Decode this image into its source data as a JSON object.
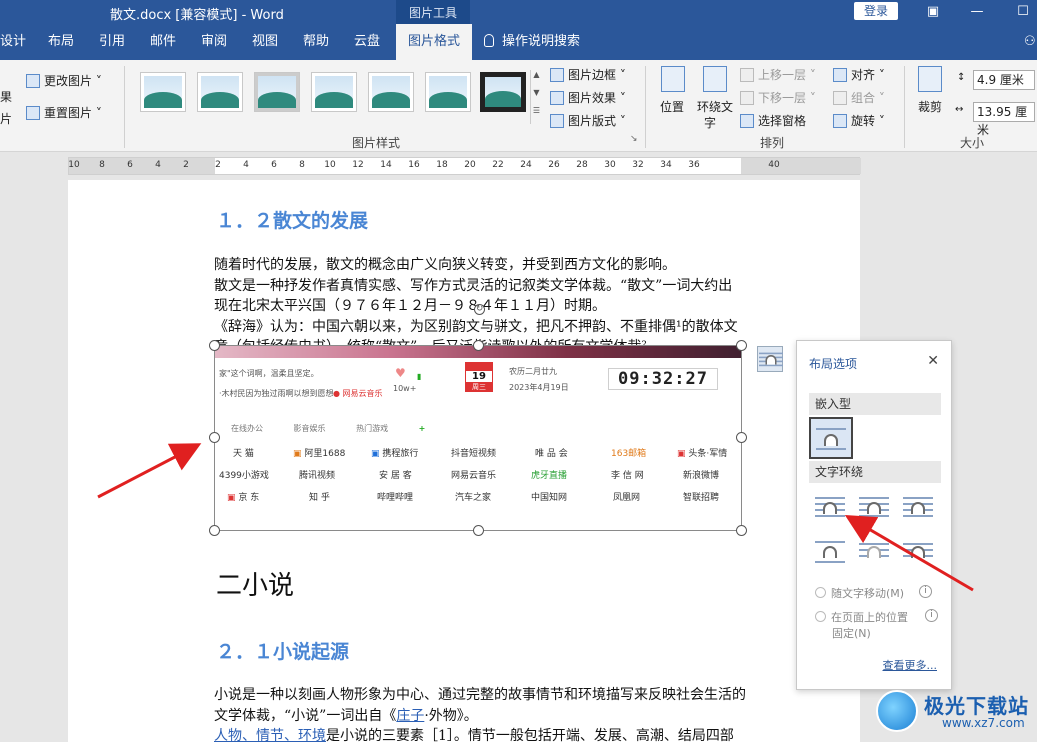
{
  "titlebar": {
    "title": "散文.docx [兼容模式]  -  Word",
    "context_tab": "图片工具",
    "login": "登录"
  },
  "tabs": [
    {
      "label": "设计"
    },
    {
      "label": "布局"
    },
    {
      "label": "引用"
    },
    {
      "label": "邮件"
    },
    {
      "label": "审阅"
    },
    {
      "label": "视图"
    },
    {
      "label": "帮助"
    },
    {
      "label": "云盘"
    },
    {
      "label": "图片格式",
      "active": true
    },
    {
      "label": "操作说明搜索"
    }
  ],
  "ribbon": {
    "left_partial_1": "果",
    "left_partial_2": "片",
    "change_pic": "更改图片",
    "reset_pic": "重置图片",
    "pic_styles_label": "图片样式",
    "pic_border": "图片边框",
    "pic_effects": "图片效果",
    "pic_layout": "图片版式",
    "position": "位置",
    "wrap_text": "环绕文",
    "wrap_text_2": "字",
    "bring_forward": "上移一层",
    "send_backward": "下移一层",
    "selection_pane": "选择窗格",
    "align": "对齐",
    "group": "组合",
    "rotate": "旋转",
    "arrange_label": "排列",
    "crop": "裁剪",
    "height": "4.9 厘米",
    "width": "13.95 厘米",
    "size_label": "大小"
  },
  "ruler": {
    "numbers": [
      "10",
      "8",
      "6",
      "4",
      "2",
      "2",
      "4",
      "6",
      "8",
      "10",
      "12",
      "14",
      "16",
      "18",
      "20",
      "22",
      "24",
      "26",
      "28",
      "30",
      "32",
      "34",
      "36",
      "40"
    ]
  },
  "doc": {
    "h_1_2": "１．２散文的发展",
    "p1": [
      "随着时代的发展，散文的概念由广义向狭义转变，并受到西方文化的影响。",
      "散文是一种抒发作者真情实感、写作方式灵活的记叙类文学体裁。“散文”一词大约出",
      "现在北宋太平兴国（９７６年１２月－９８４年１１月）时期。",
      "《辞海》认为：中国六朝以来，为区别韵文与骈文，把凡不押韵、不重排偶¹的散体文",
      "章（包括经传史书），统称“散文”。后又泛指诗歌以外的所有文学体裁²"
    ],
    "h_novel": "二小说",
    "h_2_1": "２．１小说起源",
    "p2_line1": "小说是一种以刻画人物形象为中心、通过完整的故事情节和环境描写来反映社会生活的",
    "p2_line2_pre": "文学体裁，“小说”一词出自《",
    "p2_line2_link": "庄子",
    "p2_line2_post": "·外物》。",
    "p2_line3_links": "人物、情节、环境",
    "p2_line3_post": "是小说的三要素［1］。情节一般包括开端、发展、高潮、结局四部"
  },
  "image": {
    "line_a": "家\"这个词啊，温柔且坚定。",
    "line_b": "·木村民因为独过雨啊以想到愿想",
    "netease": "网易云音乐",
    "count": "10w+",
    "cal_day": "19",
    "cal_week": "周三",
    "lunar": "农历二月廿九",
    "date": "2023年4月19日",
    "clock": "09:32:27",
    "tabs": [
      "在线办公",
      "影音娱乐",
      "热门游戏",
      "+"
    ],
    "rows": [
      [
        "天 猫",
        "阿里1688",
        "携程旅行",
        "抖音短视频",
        "唯 品 会",
        "163邮箱",
        "头条·军情"
      ],
      [
        "4399小游戏",
        "腾讯视频",
        "安 居 客",
        "网易云音乐",
        "虎牙直播",
        "李 信 网",
        "新浪微博"
      ],
      [
        "京 东",
        "知 乎",
        "哔哩哔哩",
        "汽车之家",
        "中国知网",
        "凤凰网",
        "智联招聘"
      ]
    ]
  },
  "layout_panel": {
    "title": "布局选项",
    "inline_section": "嵌入型",
    "wrap_section": "文字环绕",
    "move_with_text": "随文字移动(M)",
    "fix_position_1": "在页面上的位置",
    "fix_position_2": "固定(N)",
    "see_more": "查看更多..."
  },
  "watermark": {
    "brand": "极光下载站",
    "url": "www.xz7.com"
  },
  "colors": {
    "word_blue": "#2b579a",
    "heading_blue": "#4a86d4",
    "arrow_red": "#e02020"
  }
}
